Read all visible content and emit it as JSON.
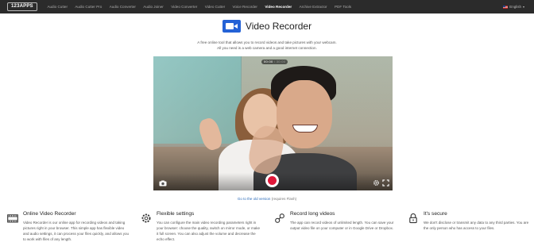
{
  "topbar": {
    "logo": "123APPS",
    "nav": [
      "Audio Cutter",
      "Audio Cutter Pro",
      "Audio Converter",
      "Audio Joiner",
      "Video Converter",
      "Video Cutter",
      "Voice Recorder",
      "Video Recorder",
      "Archive Extractor",
      "PDF Tools"
    ],
    "active_index": 7,
    "language": "English"
  },
  "hero": {
    "title": "Video Recorder",
    "description": "A free online tool that allows you to record videos and take pictures with your webcam. All you need is a web camera and a good internet connection."
  },
  "player": {
    "time_elapsed": "00:00",
    "time_separator": "/",
    "time_limit": "30:00"
  },
  "old_version": {
    "link": "Go to the old version",
    "note": "(requires Flash)"
  },
  "features": [
    {
      "icon": "film-strip-icon",
      "title": "Online Video Recorder",
      "text": "Video Recorder is our online app for recording videos and taking pictures right in your browser. This simple app has flexible video and audio settings, it can process your files quickly, and allows you to work with files of any length."
    },
    {
      "icon": "settings-icon",
      "title": "Flexible settings",
      "text": "You can configure the main video recording parameters right in your browser: choose the quality, switch on mirror mode, or make it full screen. You can also adjust the volume and decrease the echo effect."
    },
    {
      "icon": "link-icon",
      "title": "Record long videos",
      "text": "The app can record videos of unlimited length. You can save your output video file on your computer or in Google Drive or Dropbox."
    },
    {
      "icon": "lock-icon",
      "title": "It's secure",
      "text": "We don't disclose or transmit any data to any third parties. You are the only person who has access to your files."
    }
  ],
  "colors": {
    "topbar": "#2b2b2b",
    "accent": "#2462d6",
    "record": "#e0183a",
    "link": "#2a6ab8"
  }
}
